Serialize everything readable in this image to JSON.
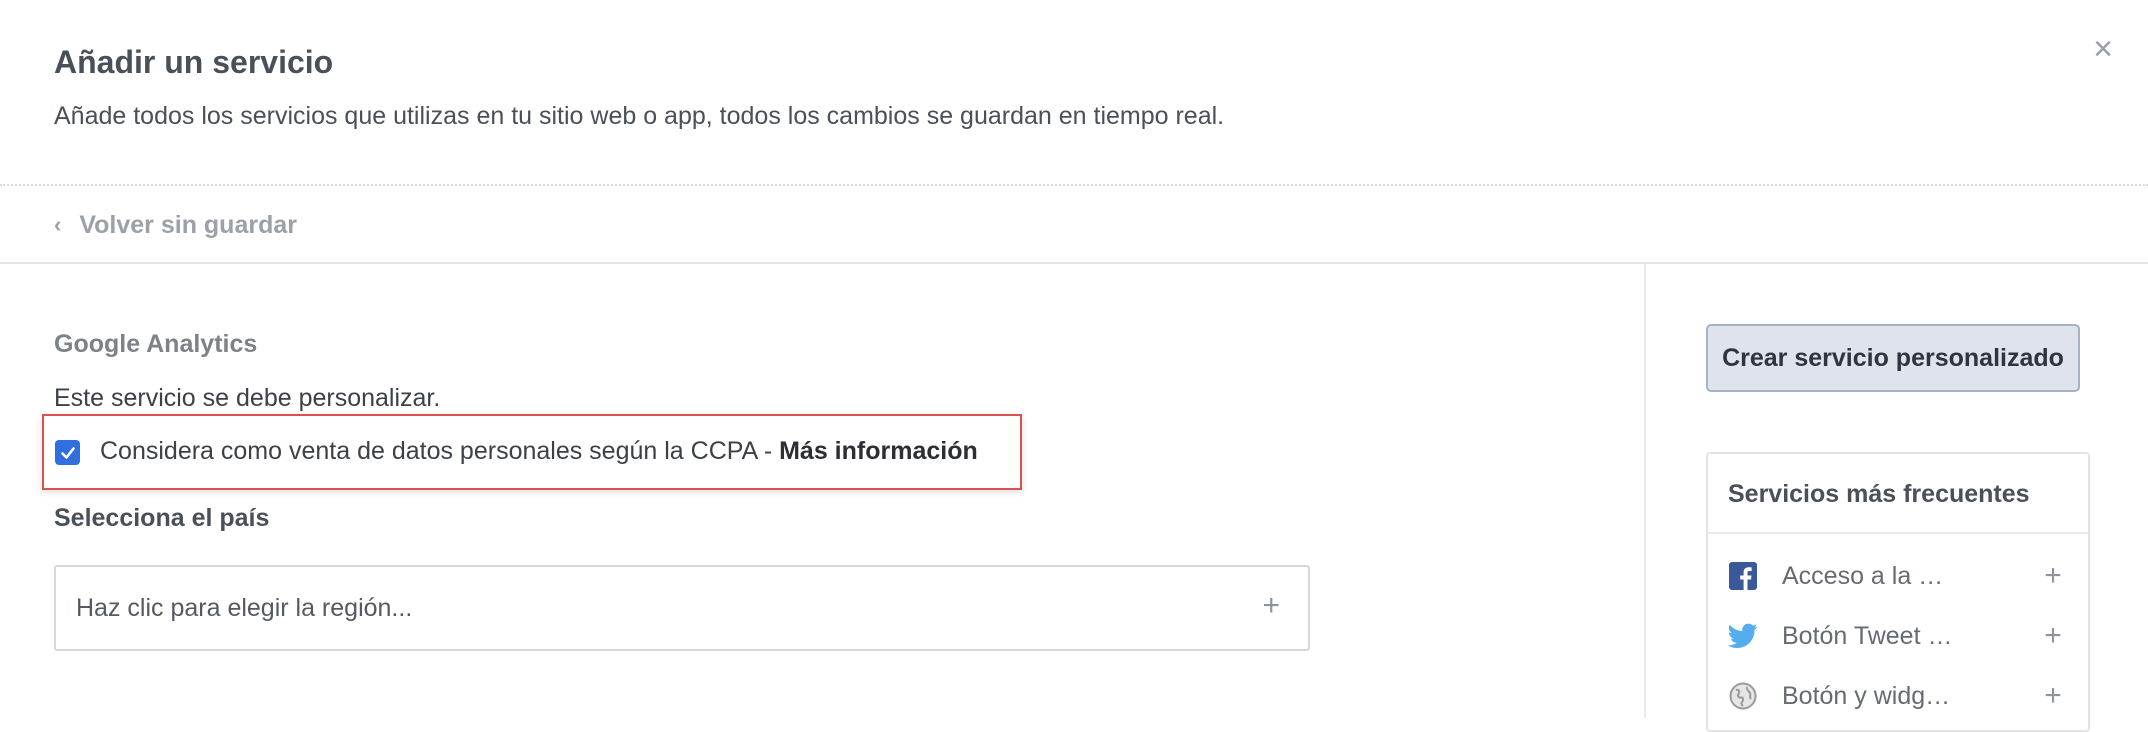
{
  "header": {
    "title": "Añadir un servicio",
    "description": "Añade todos los servicios que utilizas en tu sitio web o app, todos los cambios se guardan en tiempo real.",
    "close_symbol": "×"
  },
  "nav": {
    "back_chevron": "‹",
    "back_label": "Volver sin guardar"
  },
  "service": {
    "name": "Google Analytics",
    "note": "Este servicio se debe personalizar.",
    "ccpa_checked": true,
    "ccpa_text": "Considera como venta de datos personales según la CCPA - ",
    "ccpa_link": "Más información"
  },
  "country": {
    "label": "Selecciona el país",
    "placeholder": "Haz clic para elegir la región...",
    "add_symbol": "+"
  },
  "sidebar": {
    "create_button": "Crear servicio personalizado",
    "frequent_title": "Servicios más frecuentes",
    "items": [
      {
        "label": "Acceso a la …",
        "icon": "facebook-icon",
        "add": "+"
      },
      {
        "label": "Botón Tweet …",
        "icon": "twitter-icon",
        "add": "+"
      },
      {
        "label": "Botón y widg…",
        "icon": "globe-icon",
        "add": "+"
      }
    ]
  },
  "colors": {
    "accent_checkbox": "#2f6fe0",
    "highlight_border": "#d9534f",
    "facebook": "#3b5998",
    "twitter": "#55acee"
  }
}
